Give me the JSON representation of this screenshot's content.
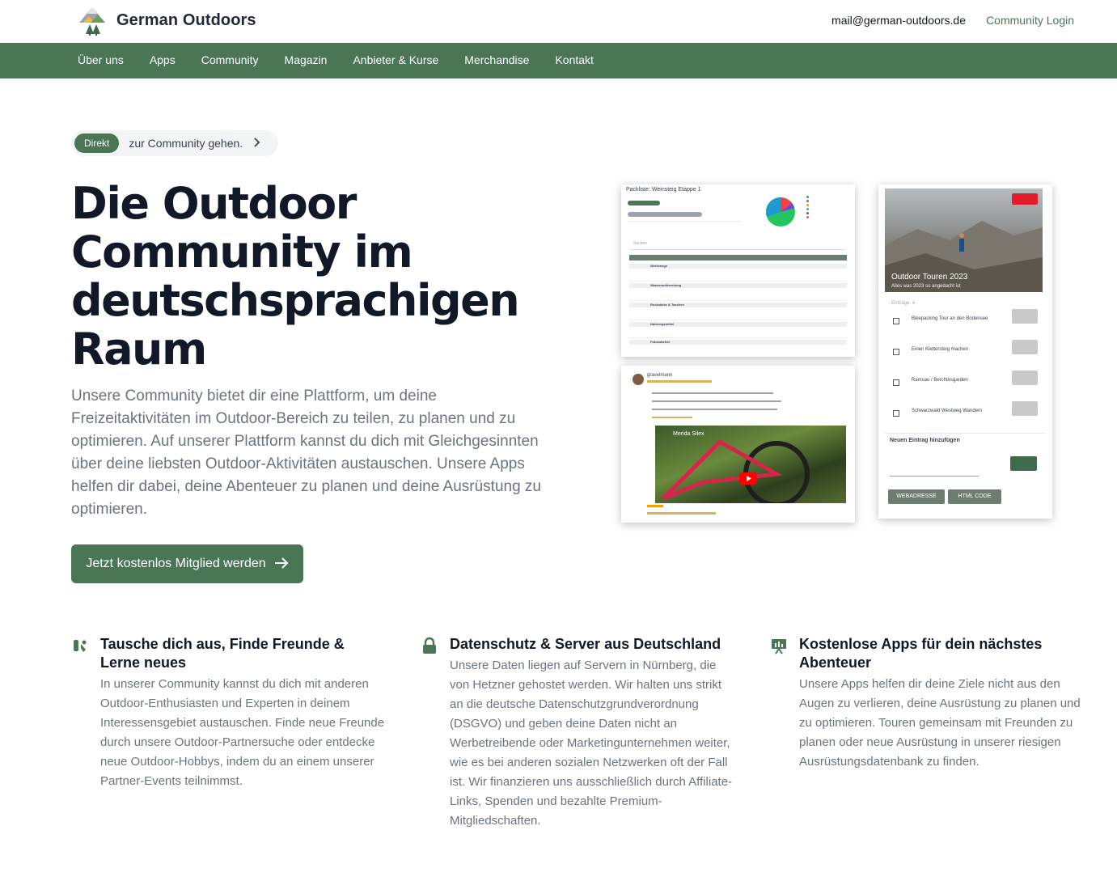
{
  "header": {
    "brand": "German Outdoors",
    "email": "mail@german-outdoors.de",
    "login": "Community Login"
  },
  "nav": {
    "items": [
      "Über uns",
      "Apps",
      "Community",
      "Magazin",
      "Anbieter & Kurse",
      "Merchandise",
      "Kontakt"
    ]
  },
  "hero": {
    "pill_badge": "Direkt",
    "pill_text": "zur Community gehen.",
    "title": "Die Outdoor Community im deutschsprachigen Raum",
    "lead": "Unsere Community bietet dir eine Plattform, um deine Freizeitaktivitäten im Outdoor-Bereich zu teilen, zu planen und zu optimieren. Auf unserer Plattform kannst du dich mit Gleichgesinnten über deine liebsten Outdoor-Aktivitäten austauschen. Unsere Apps helfen dir dabei, deine Abenteuer zu planen und deine Ausrüstung zu optimieren.",
    "cta": "Jetzt kostenlos Mitglied werden"
  },
  "screens": {
    "packlist_title": "Packliste: Weinsteig Etappe 1",
    "packlist_search": "Suchen",
    "packlist_categories": [
      "Werkzeuge",
      "Wasseraufbereitung",
      "Rucksäcke & Taschen",
      "Nahrungsmittel",
      "Fotozubehör"
    ],
    "post_user": "gravelmann",
    "video_title": "Merida Silex",
    "tours_title": "Outdoor Touren 2023",
    "tours_subtitle": "Alles was 2023 so angedacht ist",
    "tours_count": "Einträge: 4",
    "tours_items": [
      "Bikepacking Tour an den Bodensee",
      "Einen Klettersteig machen",
      "Ramsau / Berchtesgarden",
      "Schwarzwald Westweg Wandern"
    ],
    "tours_add": "Neuen Eintrag hinzufügen",
    "btn_web": "WEBADRESSE",
    "btn_html": "HTML CODE"
  },
  "features": [
    {
      "icon": "people-icon",
      "title": "Tausche dich aus, Finde Freunde & Lerne neues",
      "text": "In unserer Community kannst du dich mit anderen Outdoor-Enthusiasten und Experten in deinem Interessensgebiet austauschen. Finde neue Freunde durch unsere Outdoor-Partnersuche oder entdecke neue Outdoor-Hobbys, indem du an einem unserer Partner-Events teilnimmst."
    },
    {
      "icon": "lock-icon",
      "title": "Datenschutz & Server aus Deutschland",
      "text": "Unsere Daten liegen auf Servern in Nürnberg, die von Hetzner gehostet werden. Wir halten uns strikt an die deutsche Datenschutzgrundverordnung (DSGVO) und geben deine Daten nicht an Werbetreibende oder Marketingunternehmen weiter, wie es bei anderen sozialen Netzwerken oft der Fall ist. Wir finanzieren uns ausschließlich durch Affiliate-Links, Spenden und bezahlte Premium-Mitgliedschaften."
    },
    {
      "icon": "presentation-chart-icon",
      "title": "Kostenlose Apps für dein nächstes Abenteuer",
      "text": "Unsere Apps helfen dir deine Ziele nicht aus den Augen zu verlieren, deine Ausrüstung zu planen und zu optimieren. Touren gemeinsam mit Freunden zu planen oder neue Ausrüstung in unserer riesigen Ausrüstungsdatenbank zu finden."
    }
  ],
  "colors": {
    "brand_green": "#4a7656",
    "text_dark": "#111827",
    "text_muted": "#6b7280"
  }
}
